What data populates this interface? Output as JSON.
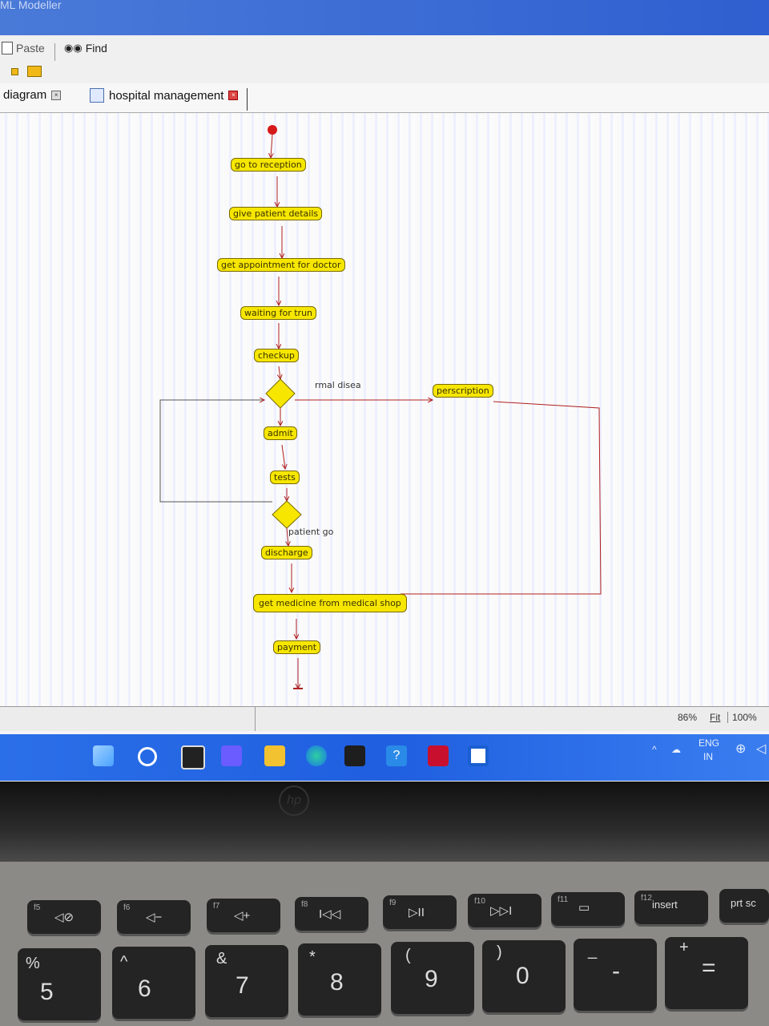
{
  "window": {
    "title": "ML Modeller"
  },
  "toolbar": {
    "paste_label": "Paste",
    "find_label": "Find"
  },
  "tabs": [
    {
      "label": "diagram"
    },
    {
      "label": "hospital management"
    }
  ],
  "diagram": {
    "nodes": [
      "go to reception",
      "give patient details",
      "get appointment for doctor",
      "waiting for trun",
      "checkup",
      "perscription",
      "admit",
      "tests",
      "discharge",
      "get medicine from medical shop",
      "payment"
    ],
    "guards": [
      "rmal disea",
      "patient go"
    ]
  },
  "statusbar": {
    "zoom_value": "86%",
    "fit_label": "Fit",
    "zoom_100_label": "100%"
  },
  "tray": {
    "lang_top": "ENG",
    "lang_bottom": "IN"
  },
  "keys": {
    "f5": {
      "fn": "f5",
      "sym": "◁⊘"
    },
    "f6": {
      "fn": "f6",
      "sym": "◁−"
    },
    "f7": {
      "fn": "f7",
      "sym": "◁+"
    },
    "f8": {
      "fn": "f8",
      "sym": "I◁◁"
    },
    "f9": {
      "fn": "f9",
      "sym": "▷II"
    },
    "f10": {
      "fn": "f10",
      "sym": "▷▷I"
    },
    "f11": {
      "fn": "f11",
      "sym": "▭"
    },
    "f12": {
      "fn": "f12",
      "sym": "insert"
    },
    "prtsc": {
      "sym": "prt sc"
    },
    "k5": {
      "top": "%",
      "main": "5"
    },
    "k6": {
      "top": "^",
      "main": "6"
    },
    "k7": {
      "top": "&",
      "main": "7"
    },
    "k8": {
      "top": "*",
      "main": "8"
    },
    "k9": {
      "top": "(",
      "main": "9"
    },
    "k0": {
      "top": ")",
      "main": "0"
    },
    "kminus": {
      "top": "_",
      "main": "-"
    },
    "kequal": {
      "top": "+",
      "main": "="
    }
  },
  "colors": {
    "node_fill": "#f6e600",
    "flow_line": "#b02020",
    "taskbar": "#1f5fe0"
  }
}
